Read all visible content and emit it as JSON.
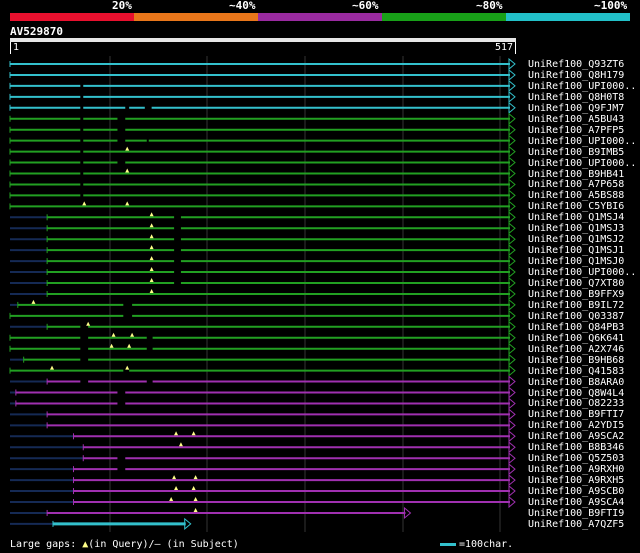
{
  "legend": {
    "labels": [
      "20%",
      "~40%",
      "~60%",
      "~80%",
      "~100%"
    ],
    "colors": [
      "#e8102e",
      "#e8761a",
      "#9a2aa0",
      "#18a018",
      "#22c0c8"
    ]
  },
  "query": {
    "name": "AV529870",
    "start": "1",
    "end": "517",
    "length": 517
  },
  "colors": {
    "cyan": "#33c0cc",
    "green": "#22a022",
    "purple": "#a030b0",
    "gap": "#000000",
    "dim": "#152a55"
  },
  "hits": [
    {
      "name": "UniRef100_Q93ZT6",
      "color": "cyan",
      "start": 0,
      "end": 517,
      "gaps": []
    },
    {
      "name": "UniRef100_Q8H179",
      "color": "cyan",
      "start": 0,
      "end": 517,
      "gaps": []
    },
    {
      "name": "UniRef100_UPI000..",
      "color": "cyan",
      "start": 0,
      "end": 517,
      "gaps": [
        [
          72,
          75
        ]
      ]
    },
    {
      "name": "UniRef100_Q8H0T8",
      "color": "cyan",
      "start": 0,
      "end": 517,
      "gaps": [
        [
          72,
          75
        ]
      ]
    },
    {
      "name": "UniRef100_Q9FJM7",
      "color": "cyan",
      "start": 0,
      "end": 517,
      "gaps": [
        [
          72,
          75
        ],
        [
          118,
          122
        ],
        [
          138,
          145
        ]
      ]
    },
    {
      "name": "UniRef100_A5BU43",
      "color": "green",
      "start": 0,
      "end": 517,
      "gaps": [
        [
          72,
          75
        ],
        [
          110,
          118
        ]
      ]
    },
    {
      "name": "UniRef100_A7PFP5",
      "color": "green",
      "start": 0,
      "end": 517,
      "gaps": [
        [
          72,
          75
        ],
        [
          110,
          118
        ]
      ]
    },
    {
      "name": "UniRef100_UPI000..",
      "color": "green",
      "start": 0,
      "end": 517,
      "gaps": [
        [
          72,
          75
        ],
        [
          110,
          118
        ],
        [
          140,
          142
        ]
      ]
    },
    {
      "name": "UniRef100_B9IMB5",
      "color": "green",
      "start": 0,
      "end": 517,
      "gaps": [
        [
          72,
          75
        ]
      ],
      "tris": [
        120
      ]
    },
    {
      "name": "UniRef100_UPI000..",
      "color": "green",
      "start": 0,
      "end": 517,
      "gaps": [
        [
          72,
          75
        ],
        [
          110,
          118
        ]
      ]
    },
    {
      "name": "UniRef100_B9HB41",
      "color": "green",
      "start": 0,
      "end": 517,
      "gaps": [
        [
          72,
          75
        ]
      ],
      "tris": [
        120
      ]
    },
    {
      "name": "UniRef100_A7P658",
      "color": "green",
      "start": 0,
      "end": 517,
      "gaps": [
        [
          72,
          75
        ]
      ]
    },
    {
      "name": "UniRef100_A5BS88",
      "color": "green",
      "start": 0,
      "end": 517,
      "gaps": [
        [
          72,
          75
        ]
      ]
    },
    {
      "name": "UniRef100_C5YBI6",
      "color": "green",
      "start": 0,
      "end": 517,
      "gaps": [],
      "tris": [
        76,
        120
      ]
    },
    {
      "name": "UniRef100_Q1MSJ4",
      "color": "green",
      "start": 38,
      "end": 517,
      "gaps": [
        [
          168,
          175
        ]
      ],
      "tris": [
        145
      ]
    },
    {
      "name": "UniRef100_Q1MSJ3",
      "color": "green",
      "start": 38,
      "end": 517,
      "gaps": [
        [
          168,
          175
        ]
      ],
      "tris": [
        145
      ]
    },
    {
      "name": "UniRef100_Q1MSJ2",
      "color": "green",
      "start": 38,
      "end": 517,
      "gaps": [
        [
          168,
          175
        ]
      ],
      "tris": [
        145
      ]
    },
    {
      "name": "UniRef100_Q1MSJ1",
      "color": "green",
      "start": 38,
      "end": 517,
      "gaps": [
        [
          168,
          175
        ]
      ],
      "tris": [
        145
      ]
    },
    {
      "name": "UniRef100_Q1MSJ0",
      "color": "green",
      "start": 38,
      "end": 517,
      "gaps": [
        [
          168,
          175
        ]
      ],
      "tris": [
        145
      ]
    },
    {
      "name": "UniRef100_UPI000..",
      "color": "green",
      "start": 38,
      "end": 517,
      "gaps": [
        [
          168,
          175
        ]
      ],
      "tris": [
        145
      ]
    },
    {
      "name": "UniRef100_Q7XT80",
      "color": "green",
      "start": 38,
      "end": 517,
      "gaps": [
        [
          168,
          175
        ]
      ],
      "tris": [
        145
      ]
    },
    {
      "name": "UniRef100_B9FFX9",
      "color": "green",
      "start": 38,
      "end": 517,
      "gaps": [],
      "tris": [
        145
      ]
    },
    {
      "name": "UniRef100_B9IL72",
      "color": "green",
      "start": 8,
      "end": 517,
      "gaps": [
        [
          116,
          125
        ]
      ],
      "tris": [
        24
      ]
    },
    {
      "name": "UniRef100_Q03387",
      "color": "green",
      "start": 0,
      "end": 517,
      "gaps": [
        [
          116,
          125
        ]
      ]
    },
    {
      "name": "UniRef100_Q84PB3",
      "color": "green",
      "start": 38,
      "end": 517,
      "gaps": [
        [
          72,
          80
        ]
      ],
      "tris": [
        80
      ]
    },
    {
      "name": "UniRef100_Q6K641",
      "color": "green",
      "start": 0,
      "end": 517,
      "gaps": [
        [
          72,
          80
        ],
        [
          140,
          146
        ]
      ],
      "tris": [
        106,
        125
      ]
    },
    {
      "name": "UniRef100_A2X746",
      "color": "green",
      "start": 0,
      "end": 517,
      "gaps": [
        [
          72,
          80
        ],
        [
          140,
          146
        ]
      ],
      "tris": [
        104,
        122
      ]
    },
    {
      "name": "UniRef100_B9HB68",
      "color": "green",
      "start": 14,
      "end": 517,
      "gaps": [
        [
          72,
          80
        ]
      ]
    },
    {
      "name": "UniRef100_Q41583",
      "color": "green",
      "start": 0,
      "end": 517,
      "gaps": [
        [
          116,
          122
        ]
      ],
      "tris": [
        43,
        120
      ]
    },
    {
      "name": "UniRef100_B8ARA0",
      "color": "purple",
      "start": 38,
      "end": 517,
      "gaps": [
        [
          72,
          80
        ],
        [
          140,
          146
        ]
      ]
    },
    {
      "name": "UniRef100_Q8W4L4",
      "color": "purple",
      "start": 6,
      "end": 517,
      "gaps": [
        [
          110,
          118
        ]
      ]
    },
    {
      "name": "UniRef100_O82233",
      "color": "purple",
      "start": 6,
      "end": 517,
      "gaps": [
        [
          110,
          118
        ]
      ]
    },
    {
      "name": "UniRef100_B9FTI7",
      "color": "purple",
      "start": 38,
      "end": 517,
      "gaps": []
    },
    {
      "name": "UniRef100_A2YDI5",
      "color": "purple",
      "start": 38,
      "end": 517,
      "gaps": []
    },
    {
      "name": "UniRef100_A9SCA2",
      "color": "purple",
      "start": 65,
      "end": 517,
      "gaps": [],
      "tris": [
        170,
        188
      ]
    },
    {
      "name": "UniRef100_B8B346",
      "color": "purple",
      "start": 75,
      "end": 517,
      "gaps": [],
      "tris": [
        175
      ]
    },
    {
      "name": "UniRef100_Q5Z503",
      "color": "purple",
      "start": 75,
      "end": 517,
      "gaps": [
        [
          110,
          118
        ]
      ]
    },
    {
      "name": "UniRef100_A9RXH0",
      "color": "purple",
      "start": 65,
      "end": 517,
      "gaps": [
        [
          110,
          118
        ]
      ]
    },
    {
      "name": "UniRef100_A9RXH5",
      "color": "purple",
      "start": 65,
      "end": 517,
      "gaps": [],
      "tris": [
        168,
        190
      ]
    },
    {
      "name": "UniRef100_A9SCB0",
      "color": "purple",
      "start": 65,
      "end": 517,
      "gaps": [],
      "tris": [
        170,
        188
      ]
    },
    {
      "name": "UniRef100_A9SCA4",
      "color": "purple",
      "start": 65,
      "end": 517,
      "gaps": [],
      "tris": [
        165,
        190
      ]
    },
    {
      "name": "UniRef100_B9FTI9",
      "color": "purple",
      "start": 38,
      "end": 410,
      "gaps": [],
      "tris": [
        190
      ]
    },
    {
      "name": "UniRef100_A7QZF5",
      "color": "cyan",
      "start": 44,
      "end": 185,
      "gaps": [],
      "thick": true
    }
  ],
  "footer": {
    "gaps_label": "Large gaps: ",
    "tri_glyph": "▲",
    "query_text": "(in Query)/– (in Subject)",
    "scale_text": "=100char."
  }
}
